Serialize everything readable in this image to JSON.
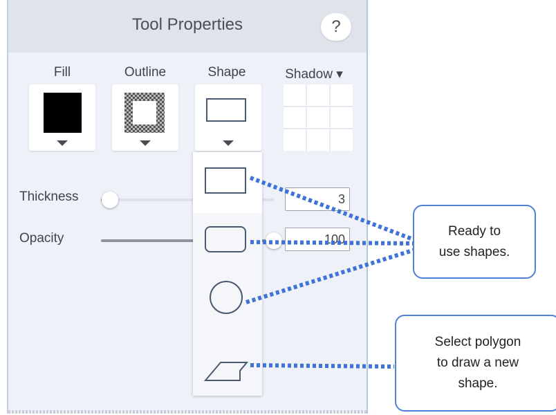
{
  "panel": {
    "title": "Tool Properties",
    "help_label": "?"
  },
  "swatches": {
    "fill_label": "Fill",
    "outline_label": "Outline",
    "shape_label": "Shape",
    "shadow_label": "Shadow ▾"
  },
  "thickness": {
    "label": "Thickness",
    "value": "3",
    "level": 0.05
  },
  "opacity": {
    "label": "Opacity",
    "value": "100",
    "level": 1.0
  },
  "shape_menu": {
    "items": [
      "rectangle",
      "rounded-rectangle",
      "ellipse",
      "polygon"
    ],
    "selected": "rectangle"
  },
  "callouts": {
    "ready_line1": "Ready to",
    "ready_line2": "use shapes.",
    "polygon_line1": "Select polygon",
    "polygon_line2": "to draw a new",
    "polygon_line3": "shape."
  },
  "colors": {
    "fill": "#000000",
    "callout_border": "#4f7fd6",
    "connector": "#3f73d8"
  }
}
